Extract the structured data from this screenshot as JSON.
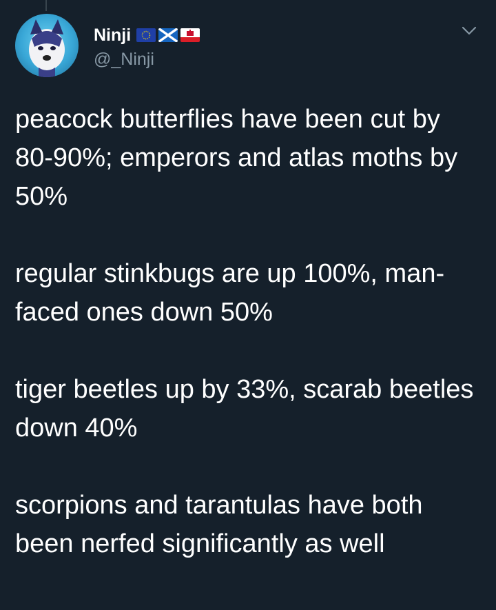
{
  "tweet": {
    "author": {
      "display_name": "Ninji",
      "handle": "@_Ninji",
      "avatar_icon": "wolf-avatar-icon",
      "flags": [
        "eu-flag-icon",
        "scotland-flag-icon",
        "gibraltar-flag-icon"
      ]
    },
    "menu_icon": "chevron-down-icon",
    "paragraphs": [
      "peacock butterflies have been cut by 80-90%; emperors and atlas moths by 50%",
      "regular stinkbugs are up 100%, man-faced ones down 50%",
      "tiger beetles up by 33%, scarab beetles down 40%",
      "scorpions and tarantulas have both been nerfed significantly as well"
    ]
  },
  "colors": {
    "background": "#15202b",
    "text": "#ffffff",
    "secondary_text": "#8899a6",
    "avatar_accent": "#38a6d6"
  }
}
